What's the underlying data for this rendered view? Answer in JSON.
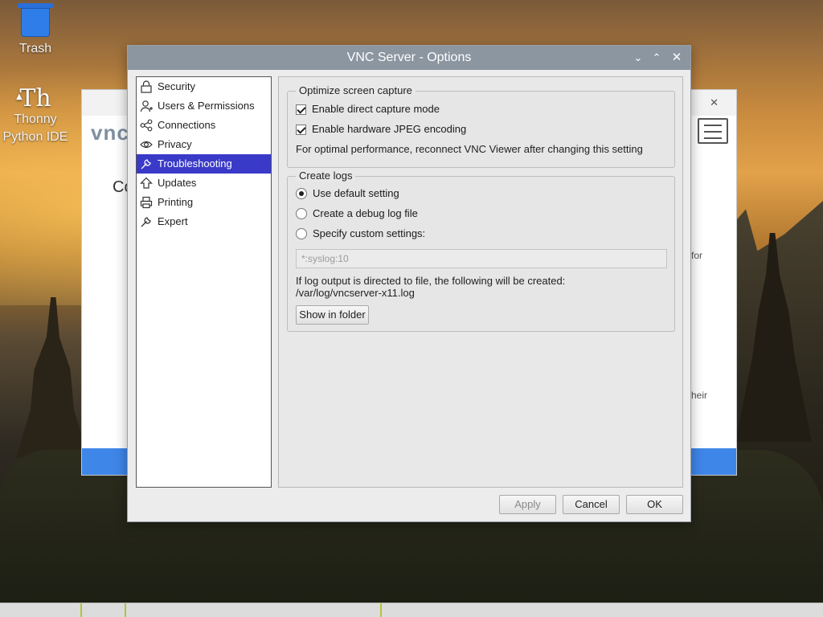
{
  "desktop": {
    "trash_label": "Trash",
    "thonny_glyph": "Th",
    "thonny_label": "Thonny Python IDE"
  },
  "background_window": {
    "logo": "vnc",
    "snippet_co": "Co",
    "snippet_for": "for",
    "snippet_heir": "heir"
  },
  "dialog": {
    "title": "VNC Server - Options",
    "nav": [
      {
        "label": "Security",
        "icon": "lock-icon"
      },
      {
        "label": "Users & Permissions",
        "icon": "user-icon"
      },
      {
        "label": "Connections",
        "icon": "share-icon"
      },
      {
        "label": "Privacy",
        "icon": "eye-icon"
      },
      {
        "label": "Troubleshooting",
        "icon": "wrench-icon"
      },
      {
        "label": "Updates",
        "icon": "arrow-up-icon"
      },
      {
        "label": "Printing",
        "icon": "printer-icon"
      },
      {
        "label": "Expert",
        "icon": "wrench-icon"
      }
    ],
    "selected_nav": "Troubleshooting",
    "capture_group": {
      "legend": "Optimize screen capture",
      "direct_capture": "Enable direct capture mode",
      "direct_capture_checked": true,
      "jpeg": "Enable hardware JPEG encoding",
      "jpeg_checked": true,
      "note": "For optimal performance, reconnect VNC Viewer after changing this setting"
    },
    "logs_group": {
      "legend": "Create logs",
      "opt_default": "Use default setting",
      "opt_debug": "Create a debug log file",
      "opt_custom": "Specify custom settings:",
      "selected_option": "Use default setting",
      "custom_value": "*:syslog:10",
      "info_line1": "If log output is directed to file, the following will be created:",
      "info_line2": "/var/log/vncserver-x11.log",
      "show_folder": "Show in folder"
    },
    "buttons": {
      "apply": "Apply",
      "cancel": "Cancel",
      "ok": "OK"
    }
  },
  "colors": {
    "titlebar": "#8c96a1",
    "selection": "#3a3ac8",
    "accent_blue": "#3e86e8"
  }
}
